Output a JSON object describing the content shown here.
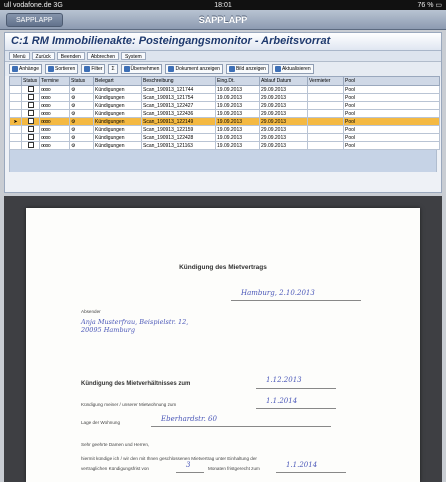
{
  "status_bar": {
    "carrier": "ull vodafone.de 3G",
    "time": "18:01",
    "battery": "76 % ▭"
  },
  "nav": {
    "back_label": "SAPPLAPP",
    "title": "SAPPLAPP"
  },
  "sap": {
    "title": "C:1 RM Immobilienakte: Posteingangsmonitor - Arbeitsvorrat",
    "menu": [
      "Menü",
      "Zurück",
      "Beenden",
      "Abbrechen",
      "System"
    ],
    "toolbar": [
      "Anhänge",
      "Sortieren",
      "Filter",
      "Σ",
      "Übernehmen",
      "Dokument anzeigen",
      "Bild anzeigen",
      "Aktualisieren"
    ],
    "columns": [
      "",
      "Status",
      "Termine",
      "Status",
      "Belegart",
      "Beschreibung",
      "Eing.Dt.",
      "Ablauf Datum",
      "Vermieter",
      "Pool"
    ],
    "rows": [
      {
        "status": "oooo",
        "icon": "⚙",
        "art": "Kündigungen",
        "desc": "Scan_190913_121744",
        "eing": "19.09.2013",
        "ablauf": "29.09.2013",
        "verm": "",
        "pool": "Pool",
        "selected": false
      },
      {
        "status": "oooo",
        "icon": "⚙",
        "art": "Kündigungen",
        "desc": "Scan_190913_121754",
        "eing": "19.09.2013",
        "ablauf": "29.09.2013",
        "verm": "",
        "pool": "Pool",
        "selected": false
      },
      {
        "status": "oooo",
        "icon": "⚙",
        "art": "Kündigungen",
        "desc": "Scan_190913_122427",
        "eing": "19.09.2013",
        "ablauf": "29.09.2013",
        "verm": "",
        "pool": "Pool",
        "selected": false
      },
      {
        "status": "oooo",
        "icon": "⚙",
        "art": "Kündigungen",
        "desc": "Scan_190913_122436",
        "eing": "19.09.2013",
        "ablauf": "29.09.2013",
        "verm": "",
        "pool": "Pool",
        "selected": false
      },
      {
        "status": "oooo",
        "icon": "⚙",
        "art": "Kündigungen",
        "desc": "Scan_190913_122149",
        "eing": "19.09.2013",
        "ablauf": "29.09.2013",
        "verm": "",
        "pool": "Pool",
        "selected": true
      },
      {
        "status": "oooo",
        "icon": "⚙",
        "art": "Kündigungen",
        "desc": "Scan_190913_122159",
        "eing": "19.09.2013",
        "ablauf": "29.09.2013",
        "verm": "",
        "pool": "Pool",
        "selected": false
      },
      {
        "status": "oooo",
        "icon": "⚙",
        "art": "Kündigungen",
        "desc": "Scan_190913_122428",
        "eing": "19.09.2013",
        "ablauf": "29.09.2013",
        "verm": "",
        "pool": "Pool",
        "selected": false
      },
      {
        "status": "oooo",
        "icon": "⚙",
        "art": "Kündigungen",
        "desc": "Scan_190913_121163",
        "eing": "19.09.2013",
        "ablauf": "29.09.2013",
        "verm": "",
        "pool": "Pool",
        "selected": false
      }
    ]
  },
  "document": {
    "title": "Kündigung des Mietvertrags",
    "place_date": "Hamburg, 2.10.2013",
    "sender_label": "Absender",
    "sender_hw": "Anja Musterfrau, Beispielstr. 12, 20095 Hamburg",
    "heading": "Kündigung des Mietverhältnisses zum",
    "heading_hw": "1.12.2013",
    "line1": "Kündigung meiner / unserer Mietwohnung zum",
    "line1_hw": "1.1.2014",
    "line2": "Lage der Wohnung",
    "line2_hw": "Eberhardstr. 60",
    "greeting": "Sehr geehrte Damen und Herren,",
    "para": "hiermit kündige ich / wir den mit Ihnen geschlossenen Mietvertrag unter Einhaltung der",
    "para2": "vertraglichen Kündigungsfrist von",
    "para2_hw": "3",
    "para2b": "Monaten fristgerecht zum",
    "para2b_hw": "1.1.2014"
  }
}
